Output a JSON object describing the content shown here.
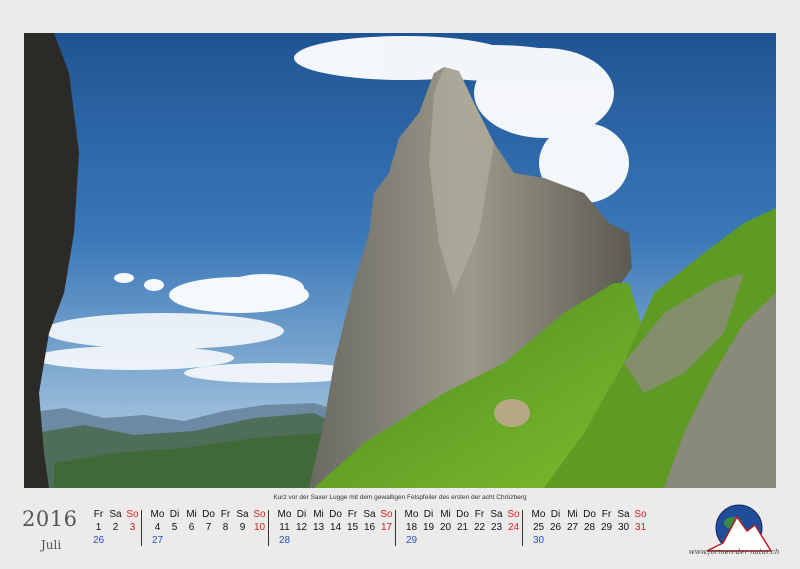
{
  "caption": "Kurz vor der Saxer Lugge mit dem gewaltigen Felspfeiler des ersten der acht Chrüzberg",
  "year": "2016",
  "month": "Juli",
  "colors": {
    "sunday": "#d42020",
    "week_number": "#2850c8",
    "text": "#111111"
  },
  "weeks": [
    {
      "kw": "26",
      "days": [
        {
          "name": "Fr",
          "num": "1"
        },
        {
          "name": "Sa",
          "num": "2"
        },
        {
          "name": "So",
          "num": "3",
          "sunday": true
        }
      ]
    },
    {
      "kw": "27",
      "days": [
        {
          "name": "Mo",
          "num": "4"
        },
        {
          "name": "Di",
          "num": "5"
        },
        {
          "name": "Mi",
          "num": "6"
        },
        {
          "name": "Do",
          "num": "7"
        },
        {
          "name": "Fr",
          "num": "8"
        },
        {
          "name": "Sa",
          "num": "9"
        },
        {
          "name": "So",
          "num": "10",
          "sunday": true
        }
      ]
    },
    {
      "kw": "28",
      "days": [
        {
          "name": "Mo",
          "num": "11"
        },
        {
          "name": "Di",
          "num": "12"
        },
        {
          "name": "Mi",
          "num": "13"
        },
        {
          "name": "Do",
          "num": "14"
        },
        {
          "name": "Fr",
          "num": "15"
        },
        {
          "name": "Sa",
          "num": "16"
        },
        {
          "name": "So",
          "num": "17",
          "sunday": true
        }
      ]
    },
    {
      "kw": "29",
      "days": [
        {
          "name": "Mo",
          "num": "18"
        },
        {
          "name": "Di",
          "num": "19"
        },
        {
          "name": "Mi",
          "num": "20"
        },
        {
          "name": "Do",
          "num": "21"
        },
        {
          "name": "Fr",
          "num": "22"
        },
        {
          "name": "Sa",
          "num": "23"
        },
        {
          "name": "So",
          "num": "24",
          "sunday": true
        }
      ]
    },
    {
      "kw": "30",
      "days": [
        {
          "name": "Mo",
          "num": "25"
        },
        {
          "name": "Di",
          "num": "26"
        },
        {
          "name": "Mi",
          "num": "27"
        },
        {
          "name": "Do",
          "num": "28"
        },
        {
          "name": "Fr",
          "num": "29"
        },
        {
          "name": "Sa",
          "num": "30"
        },
        {
          "name": "So",
          "num": "31",
          "sunday": true
        }
      ]
    }
  ],
  "logo": {
    "icon": "globe-mountain-logo",
    "url_text": "www.formen-der-natur.ch"
  }
}
